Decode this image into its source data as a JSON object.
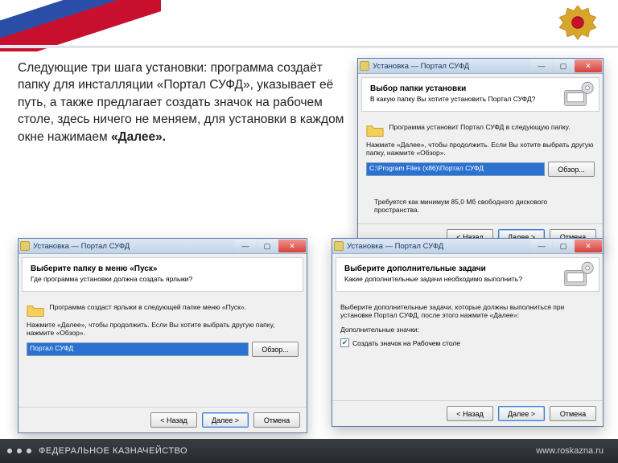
{
  "slide": {
    "body_text": "Следующие три шага установки: программа создаёт папку для инсталляции «Портал СУФД», указывает её путь, а также предлагает создать значок на рабочем столе, здесь ничего не меняем,  для установки  в каждом окне  нажимаем ",
    "body_bold": "«Далее»."
  },
  "footer": {
    "org": "ФЕДЕРАЛЬНОЕ КАЗНАЧЕЙСТВО",
    "url": "www.roskazna.ru"
  },
  "common": {
    "title": "Установка — Портал СУФД",
    "btn_back": "< Назад",
    "btn_next": "Далее >",
    "btn_cancel": "Отмена",
    "btn_browse": "Обзор..."
  },
  "win1": {
    "step_title": "Выбор папки установки",
    "step_sub": "В какую папку Вы хотите установить Портал СУФД?",
    "line1": "Программа установит Портал СУФД в следующую папку.",
    "line2": "Нажмите «Далее», чтобы продолжить. Если Вы хотите выбрать другую папку, нажмите «Обзор».",
    "path": "C:\\Program Files (x86)\\Портал СУФД",
    "req": "Требуется как минимум 85,0 Мб свободного дискового пространства."
  },
  "win2": {
    "step_title": "Выберите папку в меню «Пуск»",
    "step_sub": "Где программа установки должна создать ярлыки?",
    "line1": "Программа создаст ярлыки в следующей папке меню «Пуск».",
    "line2": "Нажмите «Далее», чтобы продолжить. Если Вы хотите выбрать другую папку, нажмите «Обзор».",
    "path": "Портал СУФД"
  },
  "win3": {
    "step_title": "Выберите дополнительные задачи",
    "step_sub": "Какие дополнительные задачи необходимо выполнить?",
    "line1": "Выберите дополнительные задачи, которые должны выполниться при установке Портал СУФД, после этого нажмите «Далее»:",
    "group": "Дополнительные значки:",
    "check": "Создать значок на Рабочем столе"
  }
}
